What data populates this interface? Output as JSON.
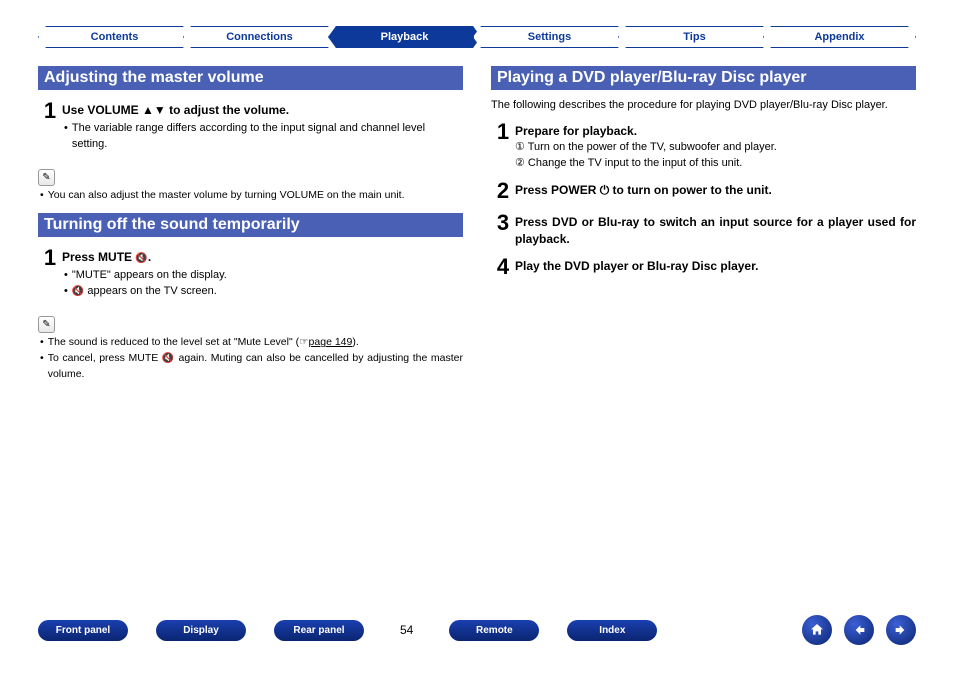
{
  "tabs": {
    "contents": "Contents",
    "connections": "Connections",
    "playback": "Playback",
    "settings": "Settings",
    "tips": "Tips",
    "appendix": "Appendix"
  },
  "left": {
    "section1": {
      "title": "Adjusting the master volume",
      "step1": {
        "title_a": "Use VOLUME ",
        "title_b": " to adjust the volume.",
        "bullet1": "The variable range differs according to the input signal and channel level setting."
      },
      "note1": "You can also adjust the master volume by turning VOLUME on the main unit."
    },
    "section2": {
      "title": "Turning off the sound temporarily",
      "step1": {
        "title_a": "Press MUTE ",
        "title_b": ".",
        "bullet1": "\"MUTE\" appears on the display.",
        "bullet2_a": "",
        "bullet2_b": " appears on the TV screen."
      },
      "note1_a": "The sound is reduced to the level set at \"Mute Level\" (",
      "note1_link": "page 149",
      "note1_b": ").",
      "note2_a": "To cancel, press MUTE ",
      "note2_b": " again. Muting can also be cancelled by adjusting the master volume."
    }
  },
  "right": {
    "section1": {
      "title": "Playing a DVD player/Blu-ray Disc player",
      "intro": "The following describes the procedure for playing DVD player/Blu-ray Disc player.",
      "step1": {
        "title": "Prepare for playback.",
        "line1": "① Turn on the power of the TV, subwoofer and player.",
        "line2": "② Change the TV input to the input of this unit."
      },
      "step2": {
        "title_a": "Press POWER ",
        "title_b": " to turn on power to the unit."
      },
      "step3": {
        "title": "Press DVD or Blu-ray to switch an input source for a player used for playback."
      },
      "step4": {
        "title": "Play the DVD player or Blu-ray Disc player."
      }
    }
  },
  "bottom": {
    "front_panel": "Front panel",
    "display": "Display",
    "rear_panel": "Rear panel",
    "remote": "Remote",
    "index": "Index",
    "page": "54"
  },
  "icons": {
    "up_down": "▲▼",
    "mute": "🔇",
    "power": "⏻",
    "pencil": "✎",
    "pointer": "☞"
  }
}
